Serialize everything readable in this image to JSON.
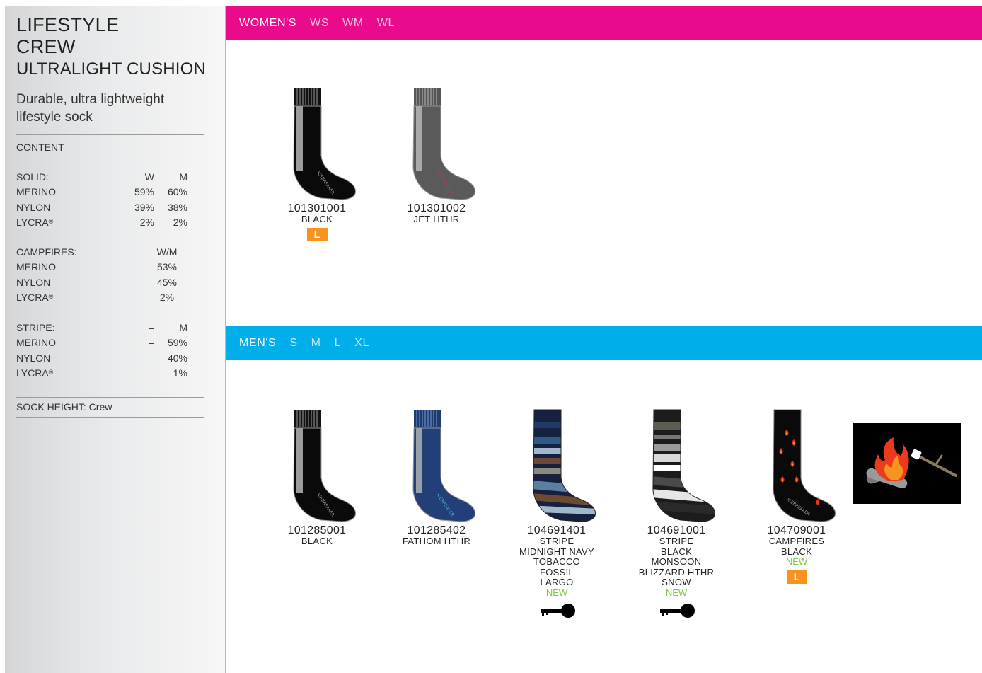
{
  "sidebar": {
    "title_line1": "LIFESTYLE",
    "title_line2": "CREW",
    "subtitle": "ULTRALIGHT CUSHION",
    "description": "Durable, ultra lightweight lifestyle sock",
    "content_heading": "CONTENT",
    "solid": {
      "label": "SOLID:",
      "col1": "W",
      "col2": "M",
      "rows": [
        {
          "name": "MERINO",
          "c1": "59%",
          "c2": "60%"
        },
        {
          "name": "NYLON",
          "c1": "39%",
          "c2": "38%"
        },
        {
          "name": "LYCRA",
          "sup": "®",
          "c1": "2%",
          "c2": "2%"
        }
      ]
    },
    "campfires": {
      "label": "CAMPFIRES:",
      "col": "W/M",
      "rows": [
        {
          "name": "MERINO",
          "v": "53%"
        },
        {
          "name": "NYLON",
          "v": "45%"
        },
        {
          "name": "LYCRA",
          "sup": "®",
          "v": "2%"
        }
      ]
    },
    "stripe": {
      "label": "STRIPE:",
      "col1": "–",
      "col2": "M",
      "rows": [
        {
          "name": "MERINO",
          "c1": "–",
          "c2": "59%"
        },
        {
          "name": "NYLON",
          "c1": "–",
          "c2": "40%"
        },
        {
          "name": "LYCRA",
          "sup": "®",
          "c1": "–",
          "c2": "1%"
        }
      ]
    },
    "sock_height": "SOCK HEIGHT: Crew"
  },
  "women": {
    "label": "WOMEN'S",
    "sizes": [
      "WS",
      "WM",
      "WL"
    ],
    "products": [
      {
        "sku": "101301001",
        "color_lines": [
          "BLACK"
        ],
        "badge": "L"
      },
      {
        "sku": "101301002",
        "color_lines": [
          "JET HTHR"
        ]
      }
    ]
  },
  "men": {
    "label": "MEN'S",
    "sizes": [
      "S",
      "M",
      "L",
      "XL"
    ],
    "products": [
      {
        "sku": "101285001",
        "color_lines": [
          "BLACK"
        ]
      },
      {
        "sku": "101285402",
        "color_lines": [
          "FATHOM HTHR"
        ]
      },
      {
        "sku": "104691401",
        "color_lines": [
          "STRIPE",
          "MIDNIGHT NAVY",
          "TOBACCO",
          "FOSSIL",
          "LARGO"
        ],
        "new": "NEW",
        "icon": "key-icon"
      },
      {
        "sku": "104691001",
        "color_lines": [
          "STRIPE",
          "BLACK",
          "MONSOON",
          "BLIZZARD HTHR",
          "SNOW"
        ],
        "new": "NEW",
        "icon": "key-icon"
      },
      {
        "sku": "104709001",
        "color_lines": [
          "CAMPFIRES",
          "BLACK"
        ],
        "new": "NEW",
        "badge": "L"
      }
    ]
  },
  "sock_brand": "ICEBREAKER",
  "colors": {
    "women_banner": "#ea0a8c",
    "men_banner": "#00aee9",
    "new": "#7ac943",
    "badge": "#f7931e"
  }
}
